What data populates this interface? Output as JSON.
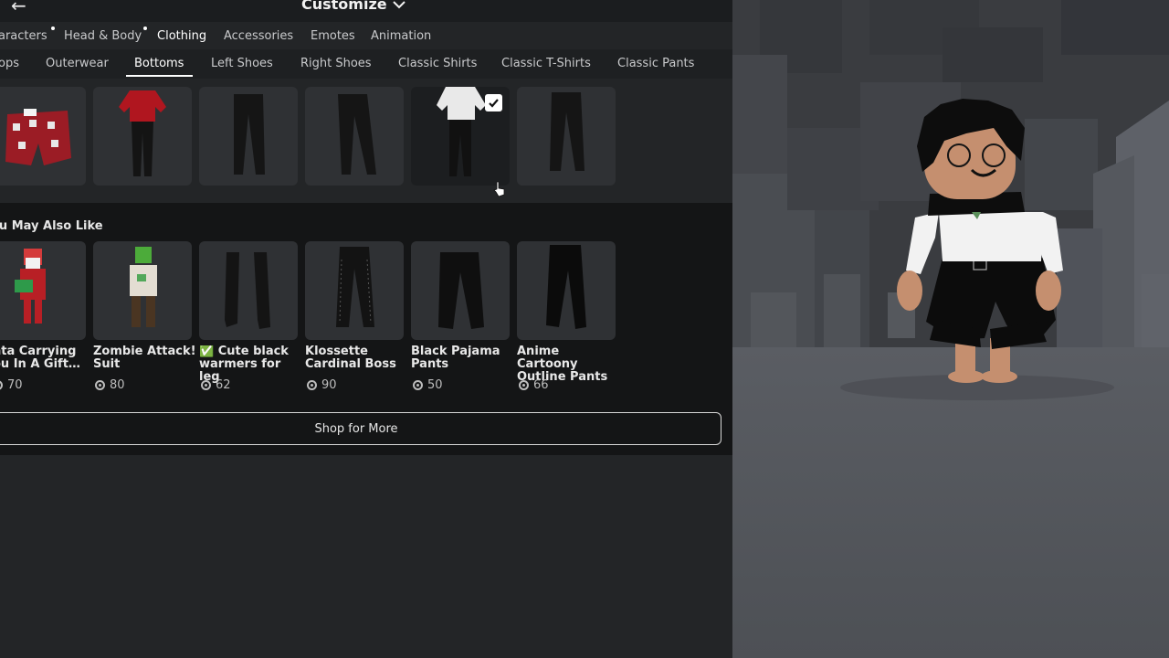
{
  "header": {
    "title": "Customize",
    "back_icon": "arrow-left-icon",
    "chevron_icon": "chevron-down-icon"
  },
  "categories": [
    {
      "label": "aracters",
      "dot": true
    },
    {
      "label": "Head & Body",
      "dot": true
    },
    {
      "label": "Clothing",
      "active": true
    },
    {
      "label": "Accessories"
    },
    {
      "label": "Emotes"
    },
    {
      "label": "Animation"
    }
  ],
  "subcategories": [
    {
      "label": "ops"
    },
    {
      "label": "Outerwear"
    },
    {
      "label": "Bottoms",
      "active": true
    },
    {
      "label": "Left Shoes"
    },
    {
      "label": "Right Shoes"
    },
    {
      "label": "Classic Shirts"
    },
    {
      "label": "Classic T-Shirts"
    },
    {
      "label": "Classic Pants"
    }
  ],
  "inventory_items": [
    {
      "icon": "red-shorts-icon"
    },
    {
      "icon": "red-shirt-outfit-icon"
    },
    {
      "icon": "black-pants-icon"
    },
    {
      "icon": "black-pants-icon"
    },
    {
      "icon": "white-shirt-pants-icon",
      "selected": true
    },
    {
      "icon": "black-pants-icon"
    }
  ],
  "recommendations": {
    "title": "ou May Also Like",
    "items": [
      {
        "name": "nta Carrying\nou In A Gift…",
        "price": "70"
      },
      {
        "name": "Zombie Attack!\nSuit",
        "price": "80"
      },
      {
        "name": "✅ Cute black\nwarmers for leg",
        "price": "62"
      },
      {
        "name": "Klossette\nCardinal Boss",
        "price": "90"
      },
      {
        "name": "Black Pajama\nPants",
        "price": "50"
      },
      {
        "name": "Anime Cartoony\nOutline Pants",
        "price": "66"
      }
    ],
    "shop_more": "Shop for More"
  },
  "colors": {
    "panel": "#232527",
    "recommend_bg": "#141516",
    "tile": "#2f3134",
    "accent": "#ffffff"
  },
  "filter_icon": "sliders-icon"
}
